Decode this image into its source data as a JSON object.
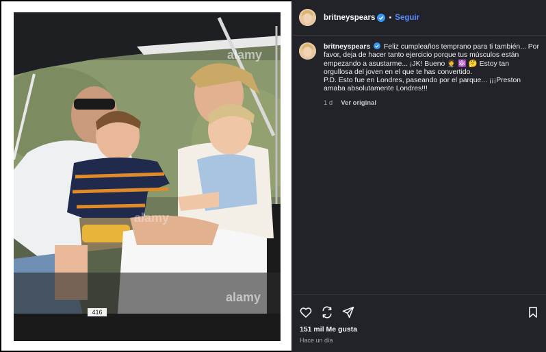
{
  "post": {
    "username": "britneyspears",
    "follow_label": "Seguir",
    "separator": "•",
    "verified_color": "#3797f0",
    "accent_link_color": "#5b8cff"
  },
  "caption": {
    "username": "britneyspears",
    "text": "Feliz cumpleaños temprano para ti también... Por favor, deja de hacer tanto ejercicio porque tus músculos están empezando a asustarme... ¡JK! Bueno 🤵 ⚛️ 🤔 Estoy tan orgullosa del joven en el que te has convertido.",
    "text_ps": "P.D. Esto fue en Londres, paseando por el parque... ¡¡¡Preston amaba absolutamente Londres!!!",
    "age": "1 d",
    "see_original": "Ver original"
  },
  "media": {
    "watermark_text": "alamy",
    "cart_plate": "416"
  },
  "actions": {
    "like_icon": "heart-icon",
    "comment_icon": "comment-icon",
    "share_icon": "share-icon",
    "save_icon": "bookmark-icon",
    "likes": "151 mil Me gusta",
    "posted": "Hace un día"
  }
}
